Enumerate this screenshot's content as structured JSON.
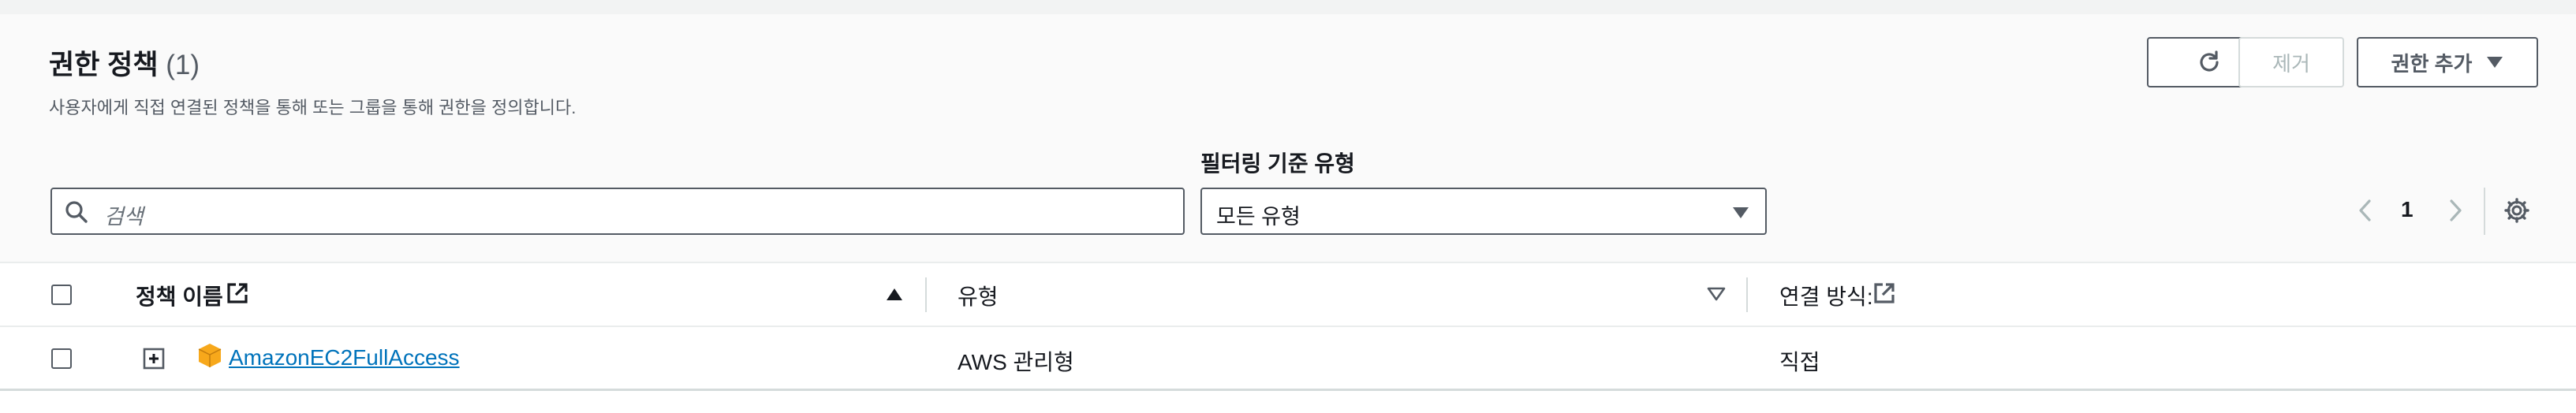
{
  "header": {
    "title": "권한 정책",
    "count": "(1)",
    "description": "사용자에게 직접 연결된 정책을 통해 또는 그룹을 통해 권한을 정의합니다."
  },
  "actions": {
    "remove_label": "제거",
    "add_label": "권한 추가"
  },
  "filter": {
    "search_placeholder": "검색",
    "type_label": "필터링 기준 유형",
    "type_value": "모든 유형"
  },
  "pagination": {
    "current_page": "1"
  },
  "table": {
    "columns": [
      {
        "label": "정책 이름",
        "sort": "ascending"
      },
      {
        "label": "유형",
        "sort": "none"
      },
      {
        "label": "연결 방식:"
      }
    ],
    "rows": [
      {
        "name": "AmazonEC2FullAccess",
        "type": "AWS 관리형",
        "attached_via": "직접"
      }
    ]
  },
  "colors": {
    "link": "#0073bb",
    "border": "#545b64",
    "aws_icon": "#f7a81b"
  }
}
